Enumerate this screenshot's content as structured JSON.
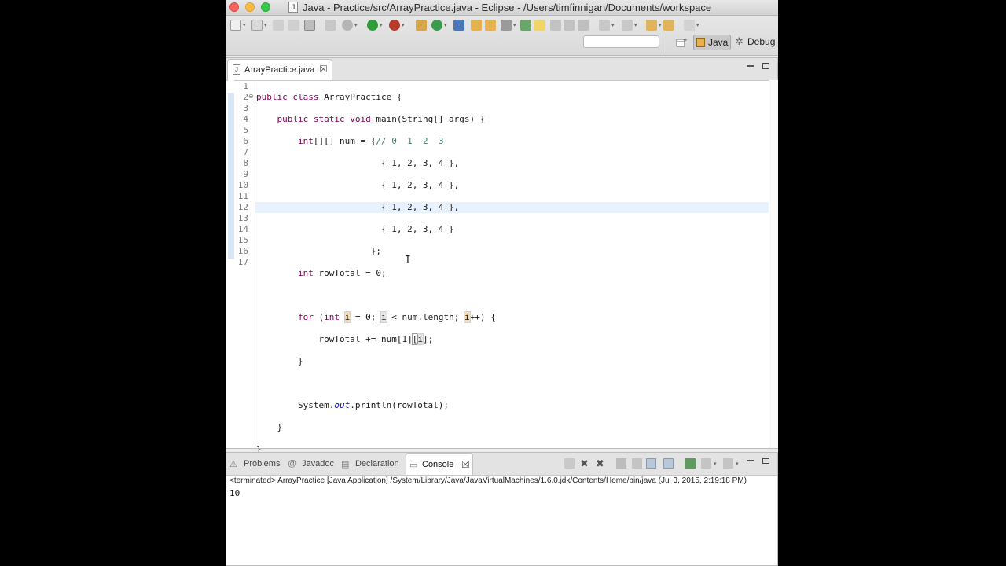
{
  "window": {
    "title": "Java - Practice/src/ArrayPractice.java - Eclipse - /Users/timfinnigan/Documents/workspace"
  },
  "perspectives": {
    "java": "Java",
    "debug": "Debug"
  },
  "quick_access": {
    "placeholder": ""
  },
  "editor": {
    "tab_label": "ArrayPractice.java",
    "tab_close": "☒",
    "line_numbers": [
      "1",
      "2",
      "3",
      "4",
      "5",
      "6",
      "7",
      "8",
      "9",
      "10",
      "11",
      "12",
      "13",
      "14",
      "15",
      "16",
      "17"
    ],
    "active_line": 12,
    "tokens": {
      "l1_kw": "public class",
      "l1_rest": " ArrayPractice {",
      "l2_kw1": "public static void",
      "l2_rest": " main(String[] args) {",
      "l3_kw": "int",
      "l3_arr": "[][]",
      "l3_mid": " num = {",
      "l3_cmt": "// 0  1  2  3",
      "row4": "{ 1, 2, 3, 4 },",
      "row5": "{ 1, 2, 3, 4 },",
      "row6": "{ 1, 2, 3, 4 },",
      "row7": "{ 1, 2, 3, 4 }",
      "l8": "};",
      "l9_kw": "int",
      "l9_rest": " rowTotal = 0;",
      "l11_kw1": "for",
      "l11_p1": " (",
      "l11_kw2": "int",
      "l11_sp": " ",
      "l11_i": "i",
      "l11_p2": " = 0; ",
      "l11_p3": " < num.length; ",
      "l11_p4": "++) {",
      "l12_p1": "rowTotal += num[1]",
      "l12_br": "[",
      "l12_p2": "];",
      "l13": "}",
      "l15_p1": "System.",
      "l15_out": "out",
      "l15_p2": ".println(rowTotal);",
      "l16": "}",
      "l17": "}"
    }
  },
  "bottom_panel": {
    "tabs": {
      "problems": "Problems",
      "javadoc": "Javadoc",
      "declaration": "Declaration",
      "console": "Console",
      "console_close": "☒"
    },
    "console_header": "<terminated> ArrayPractice [Java Application] /System/Library/Java/JavaVirtualMachines/1.6.0.jdk/Contents/Home/bin/java (Jul 3, 2015, 2:19:18 PM)",
    "console_output": "10"
  },
  "icons": {
    "title_file": "j-file-icon",
    "editor_tab_file": "java-file-icon",
    "problems": "problems-icon",
    "javadoc": "javadoc-icon",
    "declaration": "declaration-icon",
    "console": "console-icon"
  },
  "colors": {
    "keyword": "#7f0055",
    "comment": "#3f7f5f",
    "field": "#0000c0",
    "current_line": "#e8f2fe"
  }
}
